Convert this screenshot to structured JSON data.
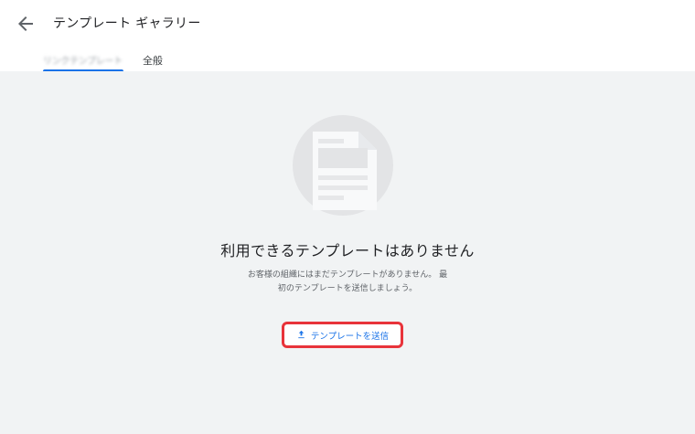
{
  "header": {
    "title": "テンプレート ギャラリー"
  },
  "tabs": [
    {
      "label": "リンクテンプレート",
      "active": true
    },
    {
      "label": "全般",
      "active": false
    }
  ],
  "empty_state": {
    "title": "利用できるテンプレートはありません",
    "description": "お客様の組織にはまだテンプレートがありません。 最初のテンプレートを送信しましょう。",
    "submit_label": "テンプレートを送信"
  },
  "colors": {
    "accent": "#1a73e8",
    "highlight": "#e8333a",
    "background": "#f1f3f4"
  },
  "icons": {
    "back": "arrow-left-icon",
    "illustration": "document-icon",
    "submit": "upload-icon"
  }
}
